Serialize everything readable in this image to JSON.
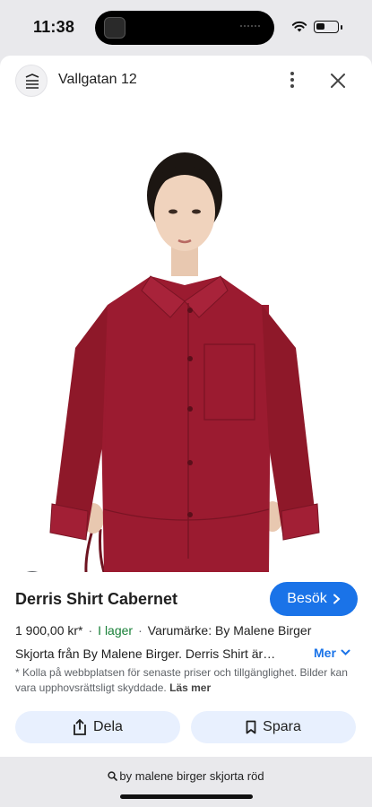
{
  "status_bar": {
    "time": "11:38"
  },
  "header": {
    "site_title": "Vallgatan 12"
  },
  "product": {
    "title": "Derris Shirt Cabernet",
    "visit_label": "Besök",
    "price": "1 900,00 kr*",
    "stock": "I lager",
    "brand": "Varumärke: By Malene Birger",
    "description": "Skjorta från By Malene Birger. Derris Shirt är…",
    "more_label": "Mer",
    "disclaimer": "* Kolla på webbplatsen för senaste priser och tillgänglighet. Bilder kan vara upphovsrättsligt skyddade.",
    "read_more": "Läs mer"
  },
  "actions": {
    "share_label": "Dela",
    "save_label": "Spara"
  },
  "search": {
    "query": "by malene birger skjorta röd"
  },
  "colors": {
    "accent": "#1a73e8",
    "stock": "#188038",
    "shirt": "#9b1b30"
  }
}
